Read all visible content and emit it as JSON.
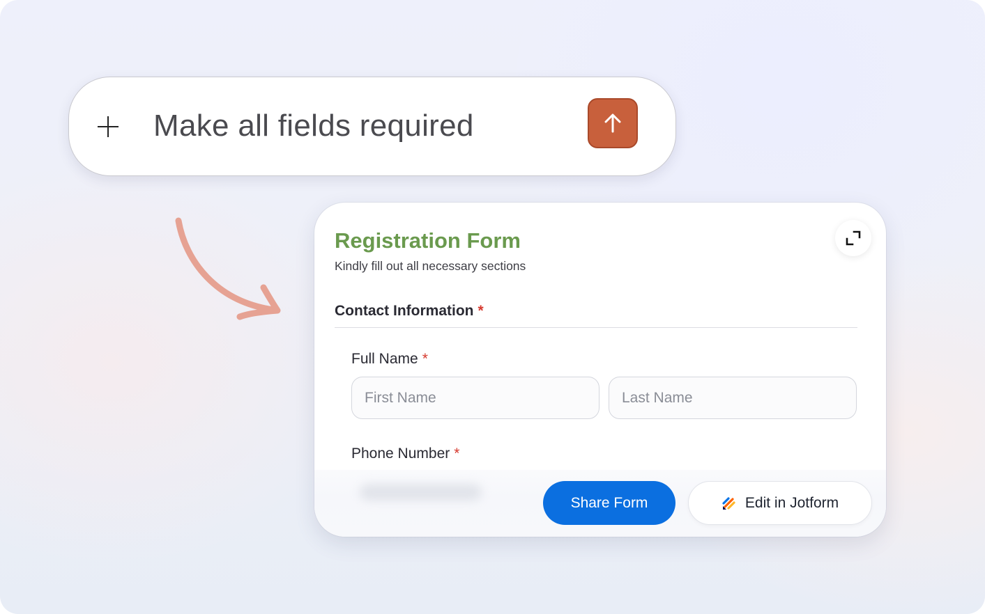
{
  "prompt": {
    "text": "Make all fields required",
    "plus_icon": "plus-icon",
    "send_icon": "arrow-up-icon",
    "send_color": "#c8603c"
  },
  "form": {
    "title": "Registration Form",
    "subtitle": "Kindly fill out all necessary sections",
    "title_color": "#6a9a4e",
    "expand_icon": "expand-icon",
    "section": {
      "label": "Contact Information",
      "required_mark": "*"
    },
    "full_name": {
      "label": "Full Name",
      "required_mark": "*",
      "first_placeholder": "First Name",
      "last_placeholder": "Last Name"
    },
    "phone": {
      "label": "Phone Number",
      "required_mark": "*"
    }
  },
  "actions": {
    "share_label": "Share Form",
    "share_color": "#0b6fe0",
    "edit_label": "Edit in Jotform",
    "edit_icon": "jotform-logo-icon"
  }
}
